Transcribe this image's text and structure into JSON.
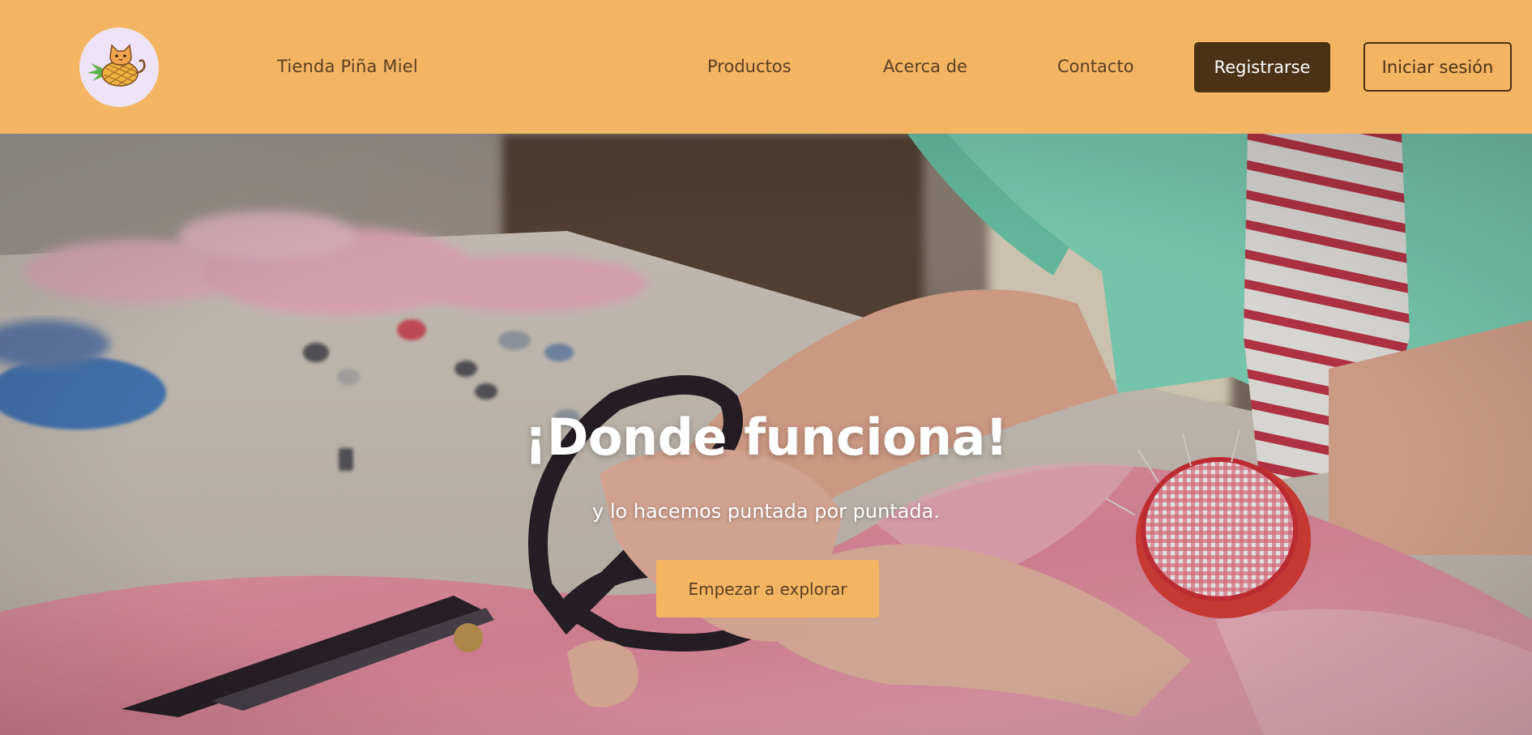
{
  "header": {
    "brand": "Tienda Piña Miel",
    "logo_icon": "pineapple-cat-icon",
    "nav": {
      "productos": "Productos",
      "acerca": "Acerca de",
      "contacto": "Contacto"
    },
    "register_label": "Registrarse",
    "login_label": "Iniciar sesión"
  },
  "hero": {
    "image_icon": "sewing-workshop-photo",
    "title": "¡Donde funciona!",
    "subtitle": "y lo hacemos puntada por puntada.",
    "cta_label": "Empezar a explorar"
  },
  "colors": {
    "header_bg": "#f3b562",
    "text_brown": "#5a3e22",
    "button_dark": "#4b3115",
    "logo_bg": "#efe4f7"
  }
}
